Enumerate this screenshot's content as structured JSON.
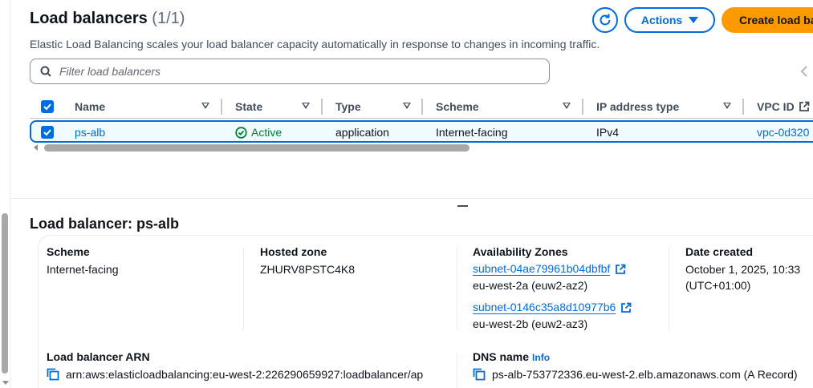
{
  "header": {
    "title": "Load balancers",
    "count": "(1/1)",
    "description": "Elastic Load Balancing scales your load balancer capacity automatically in response to changes in incoming traffic.",
    "actions_label": "Actions",
    "create_label": "Create load ba"
  },
  "filter": {
    "placeholder": "Filter load balancers"
  },
  "table": {
    "columns": [
      "Name",
      "State",
      "Type",
      "Scheme",
      "IP address type",
      "VPC ID"
    ],
    "rows": [
      {
        "selected": true,
        "name": "ps-alb",
        "state": "Active",
        "type": "application",
        "scheme": "Internet-facing",
        "ip_address_type": "IPv4",
        "vpc_id": "vpc-0d320"
      }
    ]
  },
  "details": {
    "title": "Load balancer: ps-alb",
    "scheme_label": "Scheme",
    "scheme_value": "Internet-facing",
    "hosted_zone_label": "Hosted zone",
    "hosted_zone_value": "ZHURV8PSTC4K8",
    "az_label": "Availability Zones",
    "azs": [
      {
        "subnet": "subnet-04ae79961b04dbfbf",
        "zone": "eu-west-2a (euw2-az2)"
      },
      {
        "subnet": "subnet-0146c35a8d10977b6",
        "zone": "eu-west-2b (euw2-az3)"
      }
    ],
    "date_label": "Date created",
    "date_line1": "October 1, 2025, 10:33",
    "date_line2": "(UTC+01:00)",
    "arn_label": "Load balancer ARN",
    "arn_value": "arn:aws:elasticloadbalancing:eu-west-2:226290659927:loadbalancer/ap",
    "dns_label": "DNS name",
    "dns_info": "Info",
    "dns_value": "ps-alb-753772336.eu-west-2.elb.amazonaws.com (A Record)"
  },
  "colors": {
    "primary": "#006ce0",
    "create_button": "#ff9900",
    "success": "#00802f"
  },
  "icons": [
    "refresh-icon",
    "caret-down-icon",
    "search-icon",
    "chevron-left-icon",
    "sort-icon",
    "check-icon",
    "status-success-icon",
    "external-link-icon",
    "copy-icon"
  ]
}
